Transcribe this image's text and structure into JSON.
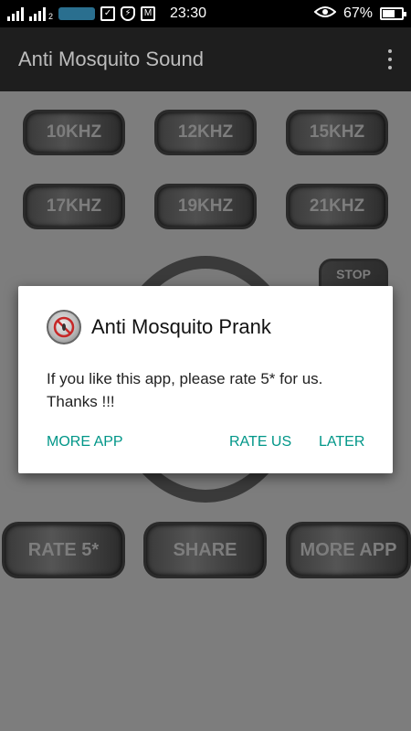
{
  "status_bar": {
    "time": "23:30",
    "battery_percent": "67%",
    "battery_level": 0.67,
    "sim2_marker": "2",
    "icons": [
      "signal-icon",
      "signal-2-icon",
      "carrier-logo-icon",
      "clipboard-check-icon",
      "shield-icon",
      "mail-icon",
      "eye-icon",
      "battery-icon"
    ]
  },
  "app_bar": {
    "title": "Anti Mosquito Sound",
    "menu_icon": "overflow-menu-icon"
  },
  "frequency_buttons": [
    {
      "label": "10KHZ"
    },
    {
      "label": "12KHZ"
    },
    {
      "label": "15KHZ"
    },
    {
      "label": "17KHZ"
    },
    {
      "label": "19KHZ"
    },
    {
      "label": "21KHZ"
    }
  ],
  "stop_button": {
    "label": "STOP"
  },
  "bottom_buttons": {
    "rate": "RATE 5*",
    "share": "SHARE",
    "more_app": "MORE APP"
  },
  "dialog": {
    "title": "Anti Mosquito Prank",
    "message": "If you like this app, please rate 5* for us. Thanks !!!",
    "actions": {
      "more_app": "MORE APP",
      "rate_us": "RATE US",
      "later": "LATER"
    },
    "icon": "no-mosquito-icon"
  },
  "colors": {
    "accent": "#009688",
    "dim_background": "#7d7d7d",
    "app_bar": "#1e1e1e",
    "status_bar": "#000000"
  }
}
